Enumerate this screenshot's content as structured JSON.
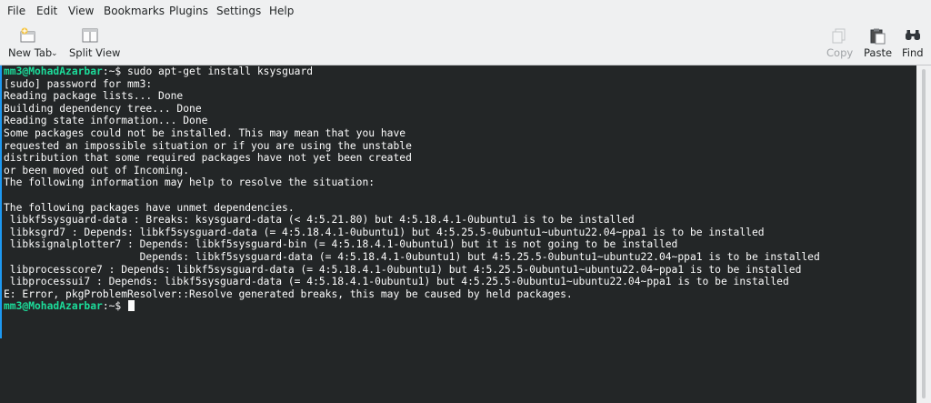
{
  "menubar": {
    "items": [
      "File",
      "Edit",
      "View",
      "Bookmarks",
      "Plugins",
      "Settings",
      "Help"
    ]
  },
  "toolbar": {
    "new_tab": {
      "label": "New Tab",
      "icon": "new-tab-icon"
    },
    "split_view": {
      "label": "Split View",
      "icon": "split-view-icon"
    },
    "copy": {
      "label": "Copy",
      "icon": "copy-icon",
      "enabled": false
    },
    "paste": {
      "label": "Paste",
      "icon": "paste-icon"
    },
    "find": {
      "label": "Find",
      "icon": "binoculars-icon"
    }
  },
  "terminal": {
    "prompt_user": "mm3@MohadAzarbar",
    "prompt_suffix": ":~$ ",
    "lines": [
      "sudo apt-get install ksysguard",
      "[sudo] password for mm3:",
      "Reading package lists... Done",
      "Building dependency tree... Done",
      "Reading state information... Done",
      "Some packages could not be installed. This may mean that you have",
      "requested an impossible situation or if you are using the unstable",
      "distribution that some required packages have not yet been created",
      "or been moved out of Incoming.",
      "The following information may help to resolve the situation:",
      "",
      "The following packages have unmet dependencies.",
      " libkf5sysguard-data : Breaks: ksysguard-data (< 4:5.21.80) but 4:5.18.4.1-0ubuntu1 is to be installed",
      " libksgrd7 : Depends: libkf5sysguard-data (= 4:5.18.4.1-0ubuntu1) but 4:5.25.5-0ubuntu1~ubuntu22.04~ppa1 is to be installed",
      " libksignalplotter7 : Depends: libkf5sysguard-bin (= 4:5.18.4.1-0ubuntu1) but it is not going to be installed",
      "                      Depends: libkf5sysguard-data (= 4:5.18.4.1-0ubuntu1) but 4:5.25.5-0ubuntu1~ubuntu22.04~ppa1 is to be installed",
      " libprocesscore7 : Depends: libkf5sysguard-data (= 4:5.18.4.1-0ubuntu1) but 4:5.25.5-0ubuntu1~ubuntu22.04~ppa1 is to be installed",
      " libprocessui7 : Depends: libkf5sysguard-data (= 4:5.18.4.1-0ubuntu1) but 4:5.25.5-0ubuntu1~ubuntu22.04~ppa1 is to be installed",
      "E: Error, pkgProblemResolver::Resolve generated breaks, this may be caused by held packages."
    ],
    "colors": {
      "background": "#232627",
      "foreground": "#fcfcfc",
      "prompt": "#1cdc9a"
    }
  }
}
